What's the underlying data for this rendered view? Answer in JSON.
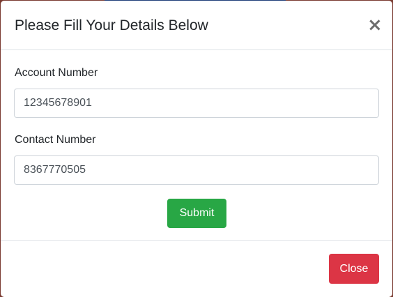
{
  "modal": {
    "title": "Please Fill Your Details Below",
    "close_icon_glyph": "×",
    "close_icon_name": "close-icon"
  },
  "form": {
    "account": {
      "label": "Account Number",
      "value": "12345678901"
    },
    "contact": {
      "label": "Contact Number",
      "value": "8367770505"
    },
    "submit_label": "Submit"
  },
  "footer": {
    "close_label": "Close"
  },
  "colors": {
    "submit": "#28a745",
    "close": "#dc3545",
    "border": "#dee2e6"
  }
}
